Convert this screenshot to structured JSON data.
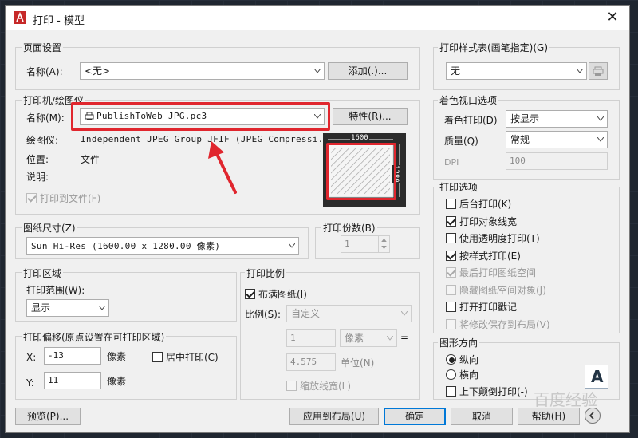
{
  "window": {
    "title": "打印 - 模型",
    "close_glyph": "✕"
  },
  "page_setup": {
    "group_title": "页面设置",
    "name_label": "名称(A):",
    "name_value": "<无>",
    "add_button": "添加(.)..."
  },
  "printer": {
    "group_title": "打印机/绘图仪",
    "name_label": "名称(M):",
    "name_value": "PublishToWeb JPG.pc3",
    "properties_button": "特性(R)...",
    "plotter_label": "绘图仪:",
    "plotter_value": "Independent JPEG Group JFIF (JPEG Compressi...",
    "location_label": "位置:",
    "location_value": "文件",
    "description_label": "说明:",
    "print_to_file": "打印到文件(F)",
    "preview_width": "1600",
    "preview_height": "1280"
  },
  "paper_size": {
    "group_title": "图纸尺寸(Z)",
    "value": "Sun Hi-Res (1600.00 x 1280.00 像素)"
  },
  "copies": {
    "group_title": "打印份数(B)",
    "value": "1"
  },
  "plot_area": {
    "group_title": "打印区域",
    "range_label": "打印范围(W):",
    "range_value": "显示"
  },
  "plot_offset": {
    "group_title": "打印偏移(原点设置在可打印区域)",
    "x_label": "X:",
    "x_value": "-13",
    "x_unit": "像素",
    "y_label": "Y:",
    "y_value": "11",
    "y_unit": "像素",
    "center_label": "居中打印(C)"
  },
  "plot_scale": {
    "group_title": "打印比例",
    "fit_label": "布满图纸(I)",
    "scale_label": "比例(S):",
    "scale_value": "自定义",
    "num_value": "1",
    "num_unit": "像素",
    "equals": "=",
    "den_value": "4.575",
    "den_unit": "单位(N)",
    "lineweights_label": "缩放线宽(L)"
  },
  "plot_style": {
    "group_title": "打印样式表(画笔指定)(G)",
    "value": "无"
  },
  "shaded_viewport": {
    "group_title": "着色视口选项",
    "shade_label": "着色打印(D)",
    "shade_value": "按显示",
    "quality_label": "质量(Q)",
    "quality_value": "常规",
    "dpi_label": "DPI",
    "dpi_value": "100"
  },
  "plot_options": {
    "group_title": "打印选项",
    "items": [
      {
        "label": "后台打印(K)",
        "checked": false,
        "disabled": false
      },
      {
        "label": "打印对象线宽",
        "checked": true,
        "disabled": false
      },
      {
        "label": "使用透明度打印(T)",
        "checked": false,
        "disabled": false
      },
      {
        "label": "按样式打印(E)",
        "checked": true,
        "disabled": false
      },
      {
        "label": "最后打印图纸空间",
        "checked": true,
        "disabled": true
      },
      {
        "label": "隐藏图纸空间对象(J)",
        "checked": false,
        "disabled": true
      },
      {
        "label": "打开打印戳记",
        "checked": false,
        "disabled": false
      },
      {
        "label": "将修改保存到布局(V)",
        "checked": false,
        "disabled": true
      }
    ]
  },
  "orientation": {
    "group_title": "图形方向",
    "portrait": "纵向",
    "landscape": "横向",
    "upside_down": "上下颠倒打印(-)",
    "icon_letter": "A"
  },
  "footer": {
    "preview_button": "预览(P)...",
    "apply_button": "应用到布局(U)",
    "ok_button": "确定",
    "cancel_button": "取消",
    "help_button": "帮助(H)"
  },
  "watermark": "百度经验",
  "colors": {
    "highlight": "#e0262e",
    "accent": "#0078d7"
  }
}
